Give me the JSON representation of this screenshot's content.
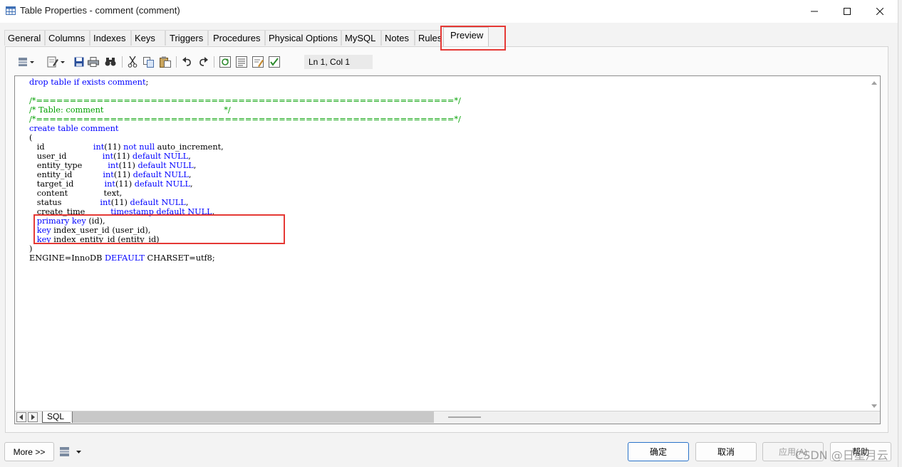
{
  "window": {
    "title": "Table Properties - comment (comment)"
  },
  "tabs": [
    "General",
    "Columns",
    "Indexes",
    "Keys",
    "Triggers",
    "Procedures",
    "Physical Options",
    "MySQL",
    "Notes",
    "Rules",
    "Preview"
  ],
  "active_tab": "Preview",
  "toolbar": {
    "position_label": "Ln 1, Col 1"
  },
  "editor": {
    "lines": [
      [
        [
          "kw",
          "drop table if exists comment"
        ],
        [
          "tx",
          ";"
        ]
      ],
      [],
      [
        [
          "cm",
          "/*==============================================================*/"
        ]
      ],
      [
        [
          "cm",
          "/* Table: comment                                               */"
        ]
      ],
      [
        [
          "cm",
          "/*==============================================================*/"
        ]
      ],
      [
        [
          "kw",
          "create table comment"
        ]
      ],
      [
        [
          "tx",
          "("
        ]
      ],
      [
        [
          "tx",
          "   id                   "
        ],
        [
          "kw",
          "int"
        ],
        [
          "tx",
          "(11) "
        ],
        [
          "kw",
          "not null"
        ],
        [
          "tx",
          " auto_increment,"
        ]
      ],
      [
        [
          "tx",
          "   user_id              "
        ],
        [
          "kw",
          "int"
        ],
        [
          "tx",
          "(11) "
        ],
        [
          "kw",
          "default NULL"
        ],
        [
          "tx",
          ","
        ]
      ],
      [
        [
          "tx",
          "   entity_type          "
        ],
        [
          "kw",
          "int"
        ],
        [
          "tx",
          "(11) "
        ],
        [
          "kw",
          "default NULL"
        ],
        [
          "tx",
          ","
        ]
      ],
      [
        [
          "tx",
          "   entity_id            "
        ],
        [
          "kw",
          "int"
        ],
        [
          "tx",
          "(11) "
        ],
        [
          "kw",
          "default NULL"
        ],
        [
          "tx",
          ","
        ]
      ],
      [
        [
          "tx",
          "   target_id            "
        ],
        [
          "kw",
          "int"
        ],
        [
          "tx",
          "(11) "
        ],
        [
          "kw",
          "default NULL"
        ],
        [
          "tx",
          ","
        ]
      ],
      [
        [
          "tx",
          "   content              "
        ],
        [
          "tx",
          "text,"
        ]
      ],
      [
        [
          "tx",
          "   status               "
        ],
        [
          "kw",
          "int"
        ],
        [
          "tx",
          "(11) "
        ],
        [
          "kw",
          "default NULL"
        ],
        [
          "tx",
          ","
        ]
      ],
      [
        [
          "tx",
          "   create_time          "
        ],
        [
          "kw",
          "timestamp default NULL"
        ],
        [
          "tx",
          ","
        ]
      ],
      [
        [
          "tx",
          "   "
        ],
        [
          "kw",
          "primary key"
        ],
        [
          "tx",
          " (id),"
        ]
      ],
      [
        [
          "tx",
          "   "
        ],
        [
          "kw",
          "key"
        ],
        [
          "tx",
          " index_user_id (user_id),"
        ]
      ],
      [
        [
          "tx",
          "   "
        ],
        [
          "kw",
          "key"
        ],
        [
          "tx",
          " index_entity_id (entity_id)"
        ]
      ],
      [
        [
          "tx",
          ")"
        ]
      ],
      [
        [
          "tx",
          "ENGINE=InnoDB "
        ],
        [
          "kw",
          "DEFAULT"
        ],
        [
          "tx",
          " CHARSET=utf8;"
        ]
      ]
    ],
    "sheet_tab": "SQL"
  },
  "buttons": {
    "more": "More >>",
    "ok": "确定",
    "cancel": "取消",
    "apply": "应用(A)",
    "help": "帮助"
  },
  "watermark": "CSDN @日星月云",
  "colors": {
    "keyword": "#0000ff",
    "comment": "#00a000",
    "highlight": "#e53935",
    "primary_border": "#2a73c9"
  }
}
